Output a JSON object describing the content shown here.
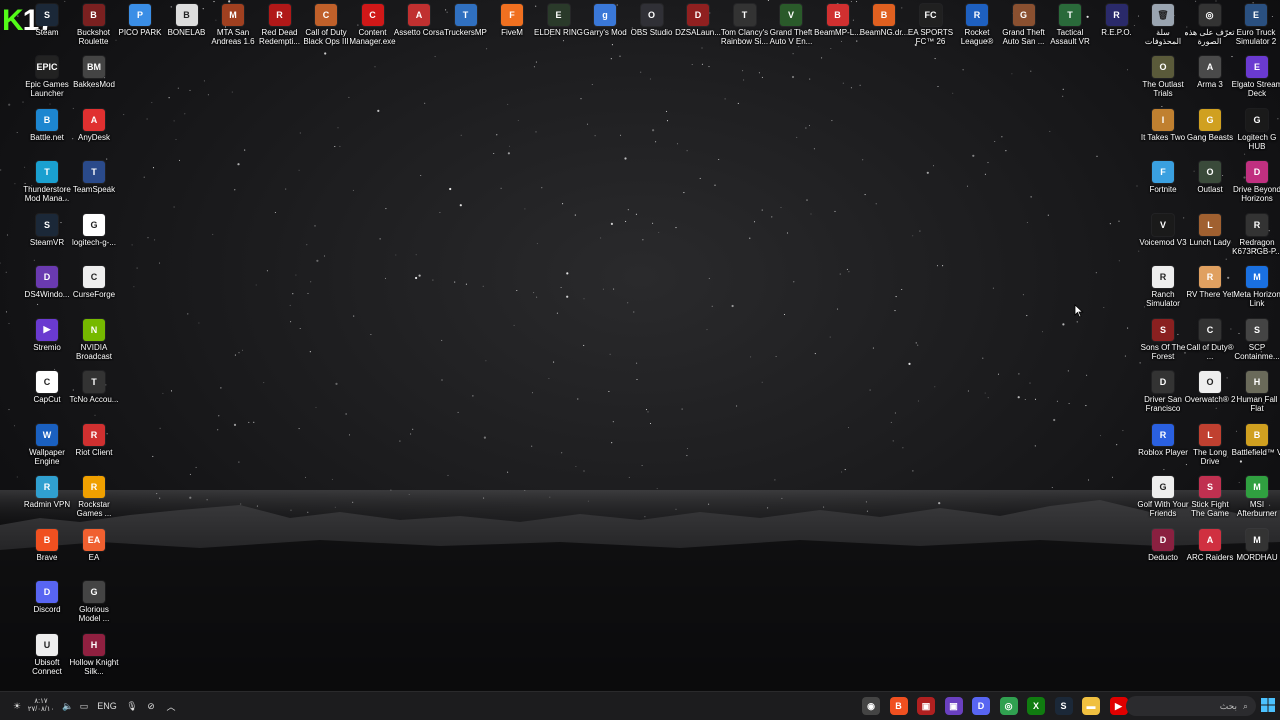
{
  "desktop": {
    "badge_number": "17",
    "icons_top": [
      {
        "label": "Steam",
        "color": "#1b2838",
        "glyph": "S"
      },
      {
        "label": "Buckshot Roulette",
        "color": "#7a2020",
        "glyph": "B"
      },
      {
        "label": "PICO PARK",
        "color": "#3a8ee6",
        "glyph": "P"
      },
      {
        "label": "BONELAB",
        "color": "#ddd",
        "glyph": "B"
      },
      {
        "label": "MTA San Andreas 1.6",
        "color": "#a04020",
        "glyph": "M"
      },
      {
        "label": "Red Dead Redempti...",
        "color": "#b01818",
        "glyph": "R"
      },
      {
        "label": "Call of Duty Black Ops III",
        "color": "#c0602a",
        "glyph": "C"
      },
      {
        "label": "Content Manager.exe",
        "color": "#d01818",
        "glyph": "C"
      },
      {
        "label": "Assetto Corsa",
        "color": "#c03030",
        "glyph": "A"
      },
      {
        "label": "TruckersMP",
        "color": "#3070c0",
        "glyph": "T"
      },
      {
        "label": "FiveM",
        "color": "#f07020",
        "glyph": "F"
      },
      {
        "label": "ELDEN RING",
        "color": "#2a3a2a",
        "glyph": "E"
      },
      {
        "label": "Garry's Mod",
        "color": "#3a78d8",
        "glyph": "g"
      },
      {
        "label": "OBS Studio",
        "color": "#303036",
        "glyph": "O"
      },
      {
        "label": "DZSALaun...",
        "color": "#902020",
        "glyph": "D"
      },
      {
        "label": "Tom Clancy's Rainbow Si...",
        "color": "#333",
        "glyph": "T"
      },
      {
        "label": "Grand Theft Auto V En...",
        "color": "#2a5a2a",
        "glyph": "V"
      },
      {
        "label": "BeamMP-L...",
        "color": "#d03030",
        "glyph": "B"
      },
      {
        "label": "BeamNG.dr...",
        "color": "#e06020",
        "glyph": "B"
      },
      {
        "label": "EA SPORTS FC™ 26",
        "color": "#202020",
        "glyph": "FC"
      },
      {
        "label": "Rocket League®",
        "color": "#1e60c0",
        "glyph": "R"
      },
      {
        "label": "Grand Theft Auto San ...",
        "color": "#8a5030",
        "glyph": "G"
      },
      {
        "label": "Tactical Assault VR",
        "color": "#2a6a3a",
        "glyph": "T"
      },
      {
        "label": "R.E.P.O.",
        "color": "#2a2a6a",
        "glyph": "R"
      },
      {
        "label": "سلة المحذوفات",
        "color": "#9aa4b0",
        "glyph": "🗑"
      },
      {
        "label": "تعرّف على هذه الصورة",
        "color": "#333",
        "glyph": "◎"
      },
      {
        "label": "Euro Truck Simulator 2",
        "color": "#2a5080",
        "glyph": "E"
      }
    ],
    "icons_left": [
      {
        "label": "Epic Games Launcher",
        "color": "#222",
        "glyph": "EPIC"
      },
      {
        "label": "BakkesMod",
        "color": "#444",
        "glyph": "BM"
      },
      {
        "label": "Battle.net",
        "color": "#1d86d0",
        "glyph": "B"
      },
      {
        "label": "AnyDesk",
        "color": "#e03030",
        "glyph": "A"
      },
      {
        "label": "Thunderstore Mod Mana...",
        "color": "#1aa0d0",
        "glyph": "T"
      },
      {
        "label": "TeamSpeak",
        "color": "#2a4a8a",
        "glyph": "T"
      },
      {
        "label": "SteamVR",
        "color": "#1b2838",
        "glyph": "S"
      },
      {
        "label": "logitech-g-...",
        "color": "#fff",
        "glyph": "G"
      },
      {
        "label": "DS4Windo...",
        "color": "#6a3ab0",
        "glyph": "D"
      },
      {
        "label": "CurseForge",
        "color": "#eee",
        "glyph": "C"
      },
      {
        "label": "Stremio",
        "color": "#6a3ad0",
        "glyph": "▶"
      },
      {
        "label": "NVIDIA Broadcast",
        "color": "#76b900",
        "glyph": "N"
      },
      {
        "label": "CapCut",
        "color": "#fff",
        "glyph": "C"
      },
      {
        "label": "TcNo Accou...",
        "color": "#333",
        "glyph": "T"
      },
      {
        "label": "Wallpaper Engine",
        "color": "#1a60c0",
        "glyph": "W"
      },
      {
        "label": "Riot Client",
        "color": "#d03030",
        "glyph": "R"
      },
      {
        "label": "Radmin VPN",
        "color": "#30a0d0",
        "glyph": "R"
      },
      {
        "label": "Rockstar Games ...",
        "color": "#f0a000",
        "glyph": "R"
      },
      {
        "label": "Brave",
        "color": "#f05020",
        "glyph": "B"
      },
      {
        "label": "EA",
        "color": "#f06030",
        "glyph": "EA"
      },
      {
        "label": "Discord",
        "color": "#5865f2",
        "glyph": "D"
      },
      {
        "label": "Glorious Model ...",
        "color": "#444",
        "glyph": "G"
      },
      {
        "label": "Ubisoft Connect",
        "color": "#eee",
        "glyph": "U"
      },
      {
        "label": "Hollow Knight Silk...",
        "color": "#902040",
        "glyph": "H"
      }
    ],
    "icons_right": [
      {
        "label": "The Outlast Trials",
        "color": "#5a5a3a",
        "glyph": "O"
      },
      {
        "label": "Arma 3",
        "color": "#4a4a4a",
        "glyph": "A"
      },
      {
        "label": "Elgato Stream Deck",
        "color": "#6a3ad0",
        "glyph": "E"
      },
      {
        "label": "It Takes Two",
        "color": "#c08030",
        "glyph": "I"
      },
      {
        "label": "Gang Beasts",
        "color": "#d0a020",
        "glyph": "G"
      },
      {
        "label": "Logitech G HUB",
        "color": "#1a1a1a",
        "glyph": "G"
      },
      {
        "label": "Fortnite",
        "color": "#3aa0e0",
        "glyph": "F"
      },
      {
        "label": "Outlast",
        "color": "#3a4a3a",
        "glyph": "O"
      },
      {
        "label": "Drive Beyond Horizons",
        "color": "#c03080",
        "glyph": "D"
      },
      {
        "label": "Voicemod V3",
        "color": "#1a1a1a",
        "glyph": "V"
      },
      {
        "label": "Lunch Lady",
        "color": "#a06030",
        "glyph": "L"
      },
      {
        "label": "Redragon K673RGB-P...",
        "color": "#333",
        "glyph": "R"
      },
      {
        "label": "Ranch Simulator",
        "color": "#eee",
        "glyph": "R"
      },
      {
        "label": "RV There Yet",
        "color": "#e0a060",
        "glyph": "R"
      },
      {
        "label": "Meta Horizon Link",
        "color": "#1a70e0",
        "glyph": "M"
      },
      {
        "label": "Sons Of The Forest",
        "color": "#8a2020",
        "glyph": "S"
      },
      {
        "label": "Call of Duty® ...",
        "color": "#333",
        "glyph": "C"
      },
      {
        "label": "SCP Containme...",
        "color": "#444",
        "glyph": "S"
      },
      {
        "label": "Driver San Francisco",
        "color": "#333",
        "glyph": "D"
      },
      {
        "label": "Overwatch® 2",
        "color": "#eee",
        "glyph": "O"
      },
      {
        "label": "Human Fall Flat",
        "color": "#6a6a5a",
        "glyph": "H"
      },
      {
        "label": "Roblox Player",
        "color": "#2a60e0",
        "glyph": "R"
      },
      {
        "label": "The Long Drive",
        "color": "#c04030",
        "glyph": "L"
      },
      {
        "label": "Battlefield™ V",
        "color": "#d0a020",
        "glyph": "B"
      },
      {
        "label": "Golf With Your Friends",
        "color": "#eee",
        "glyph": "G"
      },
      {
        "label": "Stick Fight The Game",
        "color": "#c03050",
        "glyph": "S"
      },
      {
        "label": "MSI Afterburner",
        "color": "#30a040",
        "glyph": "M"
      },
      {
        "label": "Deducto",
        "color": "#8a2040",
        "glyph": "D"
      },
      {
        "label": "ARC Raiders",
        "color": "#d03040",
        "glyph": "A"
      },
      {
        "label": "MORDHAU",
        "color": "#333",
        "glyph": "M"
      }
    ]
  },
  "taskbar": {
    "clock_time": "٨:١٧",
    "clock_date": "٢٧/٠٨/١٠",
    "language": "ENG",
    "search_placeholder": "بحث",
    "pinned": [
      {
        "name": "steam-alt",
        "color": "#444",
        "glyph": "◉"
      },
      {
        "name": "brave",
        "color": "#f05020",
        "glyph": "B"
      },
      {
        "name": "app-red",
        "color": "#b02020",
        "glyph": "▣"
      },
      {
        "name": "app-purple",
        "color": "#6a40c0",
        "glyph": "▣"
      },
      {
        "name": "discord",
        "color": "#5865f2",
        "glyph": "D"
      },
      {
        "name": "chrome",
        "color": "#30a050",
        "glyph": "◎"
      },
      {
        "name": "xbox",
        "color": "#107c10",
        "glyph": "X"
      },
      {
        "name": "steam",
        "color": "#1b2838",
        "glyph": "S"
      },
      {
        "name": "file-explorer",
        "color": "#f0c040",
        "glyph": "▬"
      },
      {
        "name": "youtube",
        "color": "#e00000",
        "glyph": "▶"
      }
    ]
  }
}
